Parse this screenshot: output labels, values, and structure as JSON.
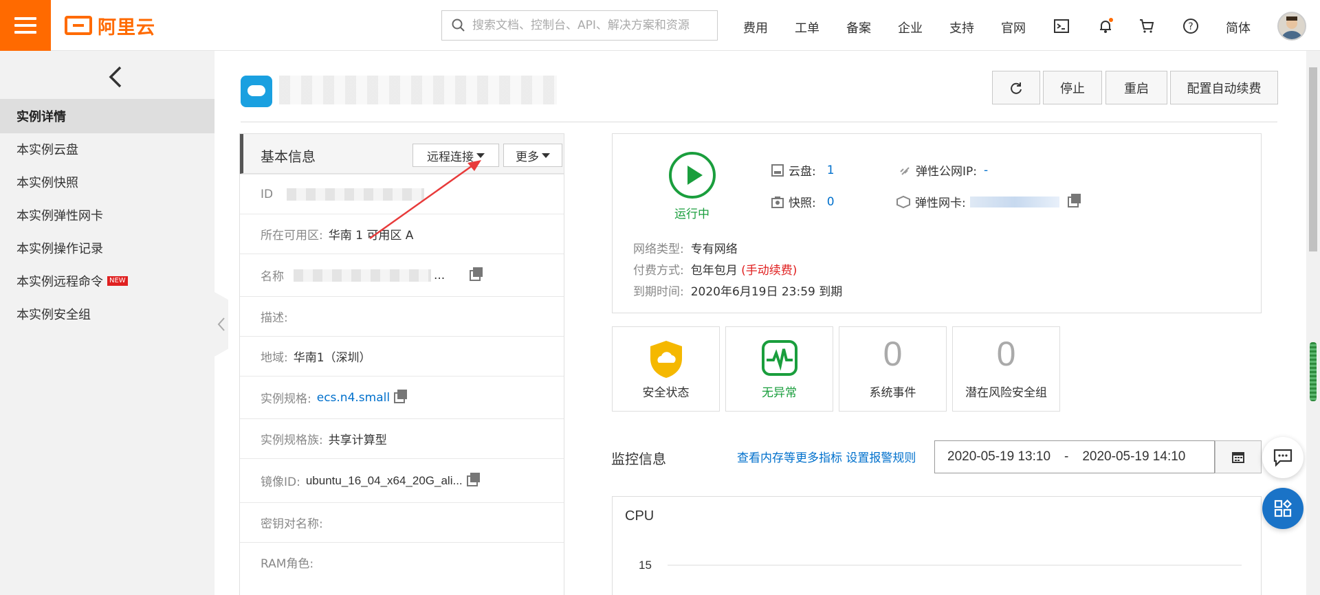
{
  "header": {
    "logo_text": "阿里云",
    "search_placeholder": "搜索文档、控制台、API、解决方案和资源",
    "nav": [
      "费用",
      "工单",
      "备案",
      "企业",
      "支持",
      "官网"
    ],
    "language": "简体",
    "brand_color": "#ff6a00"
  },
  "sidebar": {
    "collapse_icon": "chevron-left-icon",
    "items": [
      {
        "label": "实例详情",
        "active": true
      },
      {
        "label": "本实例云盘"
      },
      {
        "label": "本实例快照"
      },
      {
        "label": "本实例弹性网卡"
      },
      {
        "label": "本实例操作记录"
      },
      {
        "label": "本实例远程命令",
        "badge": "NEW"
      },
      {
        "label": "本实例安全组"
      }
    ]
  },
  "toolbar": {
    "stop": "停止",
    "restart": "重启",
    "auto_renew": "配置自动续费"
  },
  "basic_info": {
    "title": "基本信息",
    "remote_connect": "远程连接",
    "more": "更多",
    "rows": {
      "id_label": "ID",
      "zone_label": "所在可用区:",
      "zone_value": "华南 1 可用区 A",
      "name_label": "名称",
      "name_suffix": "...",
      "desc_label": "描述:",
      "region_label": "地域:",
      "region_value": "华南1（深圳）",
      "spec_label": "实例规格:",
      "spec_value": "ecs.n4.small",
      "family_label": "实例规格族:",
      "family_value": "共享计算型",
      "image_label": "镜像ID:",
      "image_value": "ubuntu_16_04_x64_20G_ali...",
      "keypair_label": "密钥对名称:",
      "ram_label": "RAM角色:"
    }
  },
  "status": {
    "running": "运行中",
    "disk_label": "云盘:",
    "disk_value": "1",
    "snapshot_label": "快照:",
    "snapshot_value": "0",
    "eip_label": "弹性公网IP:",
    "eip_value": "-",
    "eni_label": "弹性网卡:",
    "network_label": "网络类型:",
    "network_value": "专有网络",
    "billing_label": "付费方式:",
    "billing_value": "包年包月",
    "billing_note": "(手动续费)",
    "expire_label": "到期时间:",
    "expire_value": "2020年6月19日 23:59 到期"
  },
  "cards": {
    "security_label": "安全状态",
    "health_label": "无异常",
    "events_value": "0",
    "events_label": "系统事件",
    "risk_value": "0",
    "risk_label": "潜在风险安全组"
  },
  "monitor": {
    "title": "监控信息",
    "link_more": "查看内存等更多指标",
    "link_alarm": "设置报警规则",
    "start": "2020-05-19 13:10",
    "separator": "-",
    "end": "2020-05-19 14:10",
    "chart_title": "CPU",
    "tick": "15"
  }
}
